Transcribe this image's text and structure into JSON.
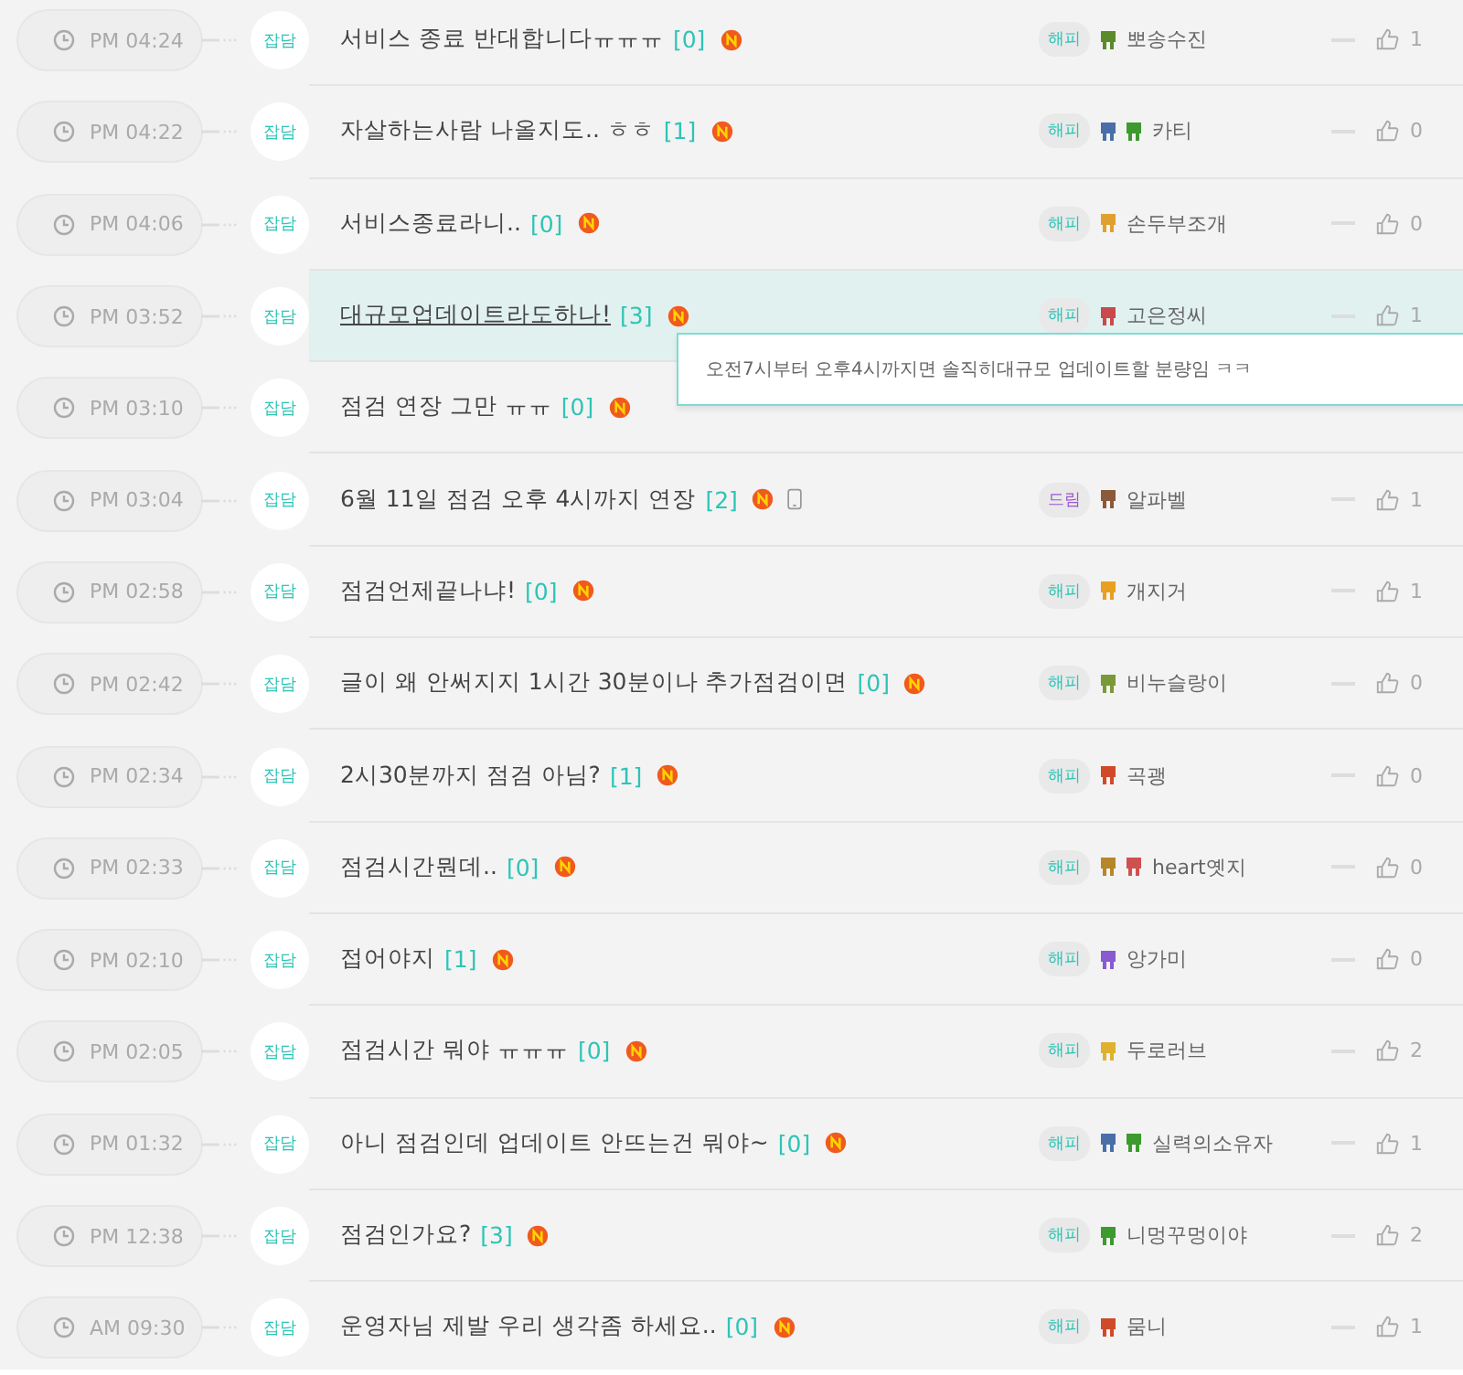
{
  "posts": [
    {
      "time": "PM 04:24",
      "category": "잡담",
      "title": "서비스 종료 반대합니다ㅠㅠㅠ",
      "comments": "[0]",
      "is_new": true,
      "mobile": false,
      "hovered": false,
      "server": {
        "label": "해피",
        "color": "#2ec4b6"
      },
      "emblems": [
        {
          "color": "#5a8a2a"
        }
      ],
      "author": "뽀송수진",
      "likes": "1"
    },
    {
      "time": "PM 04:22",
      "category": "잡담",
      "title": "자살하는사람 나올지도.. ㅎㅎ",
      "comments": "[1]",
      "is_new": true,
      "mobile": false,
      "hovered": false,
      "server": {
        "label": "해피",
        "color": "#2ec4b6"
      },
      "emblems": [
        {
          "color": "#4a6fa8"
        },
        {
          "color": "#3c9a2e"
        }
      ],
      "author": "카티",
      "likes": "0"
    },
    {
      "time": "PM 04:06",
      "category": "잡담",
      "title": "서비스종료라니..",
      "comments": "[0]",
      "is_new": true,
      "mobile": false,
      "hovered": false,
      "server": {
        "label": "해피",
        "color": "#2ec4b6"
      },
      "emblems": [
        {
          "color": "#e0a030"
        }
      ],
      "author": "손두부조개",
      "likes": "0"
    },
    {
      "time": "PM 03:52",
      "category": "잡담",
      "title": "대규모업데이트라도하나!",
      "comments": "[3]",
      "is_new": true,
      "mobile": false,
      "hovered": true,
      "server": {
        "label": "해피",
        "color": "#2ec4b6"
      },
      "emblems": [
        {
          "color": "#c84a4a"
        }
      ],
      "author": "고은정씨",
      "likes": "1"
    },
    {
      "time": "PM 03:10",
      "category": "잡담",
      "title": "점검 연장 그만 ㅠㅠ",
      "comments": "[0]",
      "is_new": true,
      "mobile": false,
      "hovered": false
    },
    {
      "time": "PM 03:04",
      "category": "잡담",
      "title": "6월 11일 점검 오후 4시까지 연장",
      "comments": "[2]",
      "is_new": true,
      "mobile": true,
      "hovered": false,
      "server": {
        "label": "드림",
        "color": "#9b59d0"
      },
      "emblems": [
        {
          "color": "#8a5a3a"
        }
      ],
      "author": "알파벨",
      "likes": "1"
    },
    {
      "time": "PM 02:58",
      "category": "잡담",
      "title": "점검언제끝나냐!",
      "comments": "[0]",
      "is_new": true,
      "mobile": false,
      "hovered": false,
      "server": {
        "label": "해피",
        "color": "#2ec4b6"
      },
      "emblems": [
        {
          "color": "#e8a020"
        }
      ],
      "author": "개지거",
      "likes": "1"
    },
    {
      "time": "PM 02:42",
      "category": "잡담",
      "title": "글이 왜 안써지지 1시간 30분이나 추가점검이면",
      "comments": "[0]",
      "is_new": true,
      "mobile": false,
      "hovered": false,
      "server": {
        "label": "해피",
        "color": "#2ec4b6"
      },
      "emblems": [
        {
          "color": "#7a9a3a"
        }
      ],
      "author": "비누슬랑이",
      "likes": "0"
    },
    {
      "time": "PM 02:34",
      "category": "잡담",
      "title": "2시30분까지 점검 아님?",
      "comments": "[1]",
      "is_new": true,
      "mobile": false,
      "hovered": false,
      "server": {
        "label": "해피",
        "color": "#2ec4b6"
      },
      "emblems": [
        {
          "color": "#d04a2a"
        }
      ],
      "author": "곡괭",
      "likes": "0"
    },
    {
      "time": "PM 02:33",
      "category": "잡담",
      "title": "점검시간뭔데..",
      "comments": "[0]",
      "is_new": true,
      "mobile": false,
      "hovered": false,
      "server": {
        "label": "해피",
        "color": "#2ec4b6"
      },
      "emblems": [
        {
          "color": "#b8862a"
        },
        {
          "color": "#d05050"
        }
      ],
      "author": "heart옛지",
      "likes": "0"
    },
    {
      "time": "PM 02:10",
      "category": "잡담",
      "title": "접어야지",
      "comments": "[1]",
      "is_new": true,
      "mobile": false,
      "hovered": false,
      "server": {
        "label": "해피",
        "color": "#2ec4b6"
      },
      "emblems": [
        {
          "color": "#8a5ad0"
        }
      ],
      "author": "앙가미",
      "likes": "0"
    },
    {
      "time": "PM 02:05",
      "category": "잡담",
      "title": "점검시간 뭐야 ㅠㅠㅠ",
      "comments": "[0]",
      "is_new": true,
      "mobile": false,
      "hovered": false,
      "server": {
        "label": "해피",
        "color": "#2ec4b6"
      },
      "emblems": [
        {
          "color": "#e0b030"
        }
      ],
      "author": "두로러브",
      "likes": "2"
    },
    {
      "time": "PM 01:32",
      "category": "잡담",
      "title": "아니 점검인데 업데이트 안뜨는건 뭐야~",
      "comments": "[0]",
      "is_new": true,
      "mobile": false,
      "hovered": false,
      "server": {
        "label": "해피",
        "color": "#2ec4b6"
      },
      "emblems": [
        {
          "color": "#4a6fa8"
        },
        {
          "color": "#3c9a2e"
        }
      ],
      "author": "실력의소유자",
      "likes": "1"
    },
    {
      "time": "PM 12:38",
      "category": "잡담",
      "title": "점검인가요?",
      "comments": "[3]",
      "is_new": true,
      "mobile": false,
      "hovered": false,
      "server": {
        "label": "해피",
        "color": "#2ec4b6"
      },
      "emblems": [
        {
          "color": "#3c9a2e"
        }
      ],
      "author": "니멍꾸멍이야",
      "likes": "2"
    },
    {
      "time": "AM 09:30",
      "category": "잡담",
      "title": "운영자님 제발 우리 생각좀 하세요..",
      "comments": "[0]",
      "is_new": true,
      "mobile": false,
      "hovered": false,
      "server": {
        "label": "해피",
        "color": "#2ec4b6"
      },
      "emblems": [
        {
          "color": "#d04a2a"
        }
      ],
      "author": "뭄니",
      "likes": "1"
    }
  ],
  "tooltip": {
    "text": "오전7시부터 오후4시까지면 솔직히대규모 업데이트할 분량임 ㅋㅋ"
  }
}
